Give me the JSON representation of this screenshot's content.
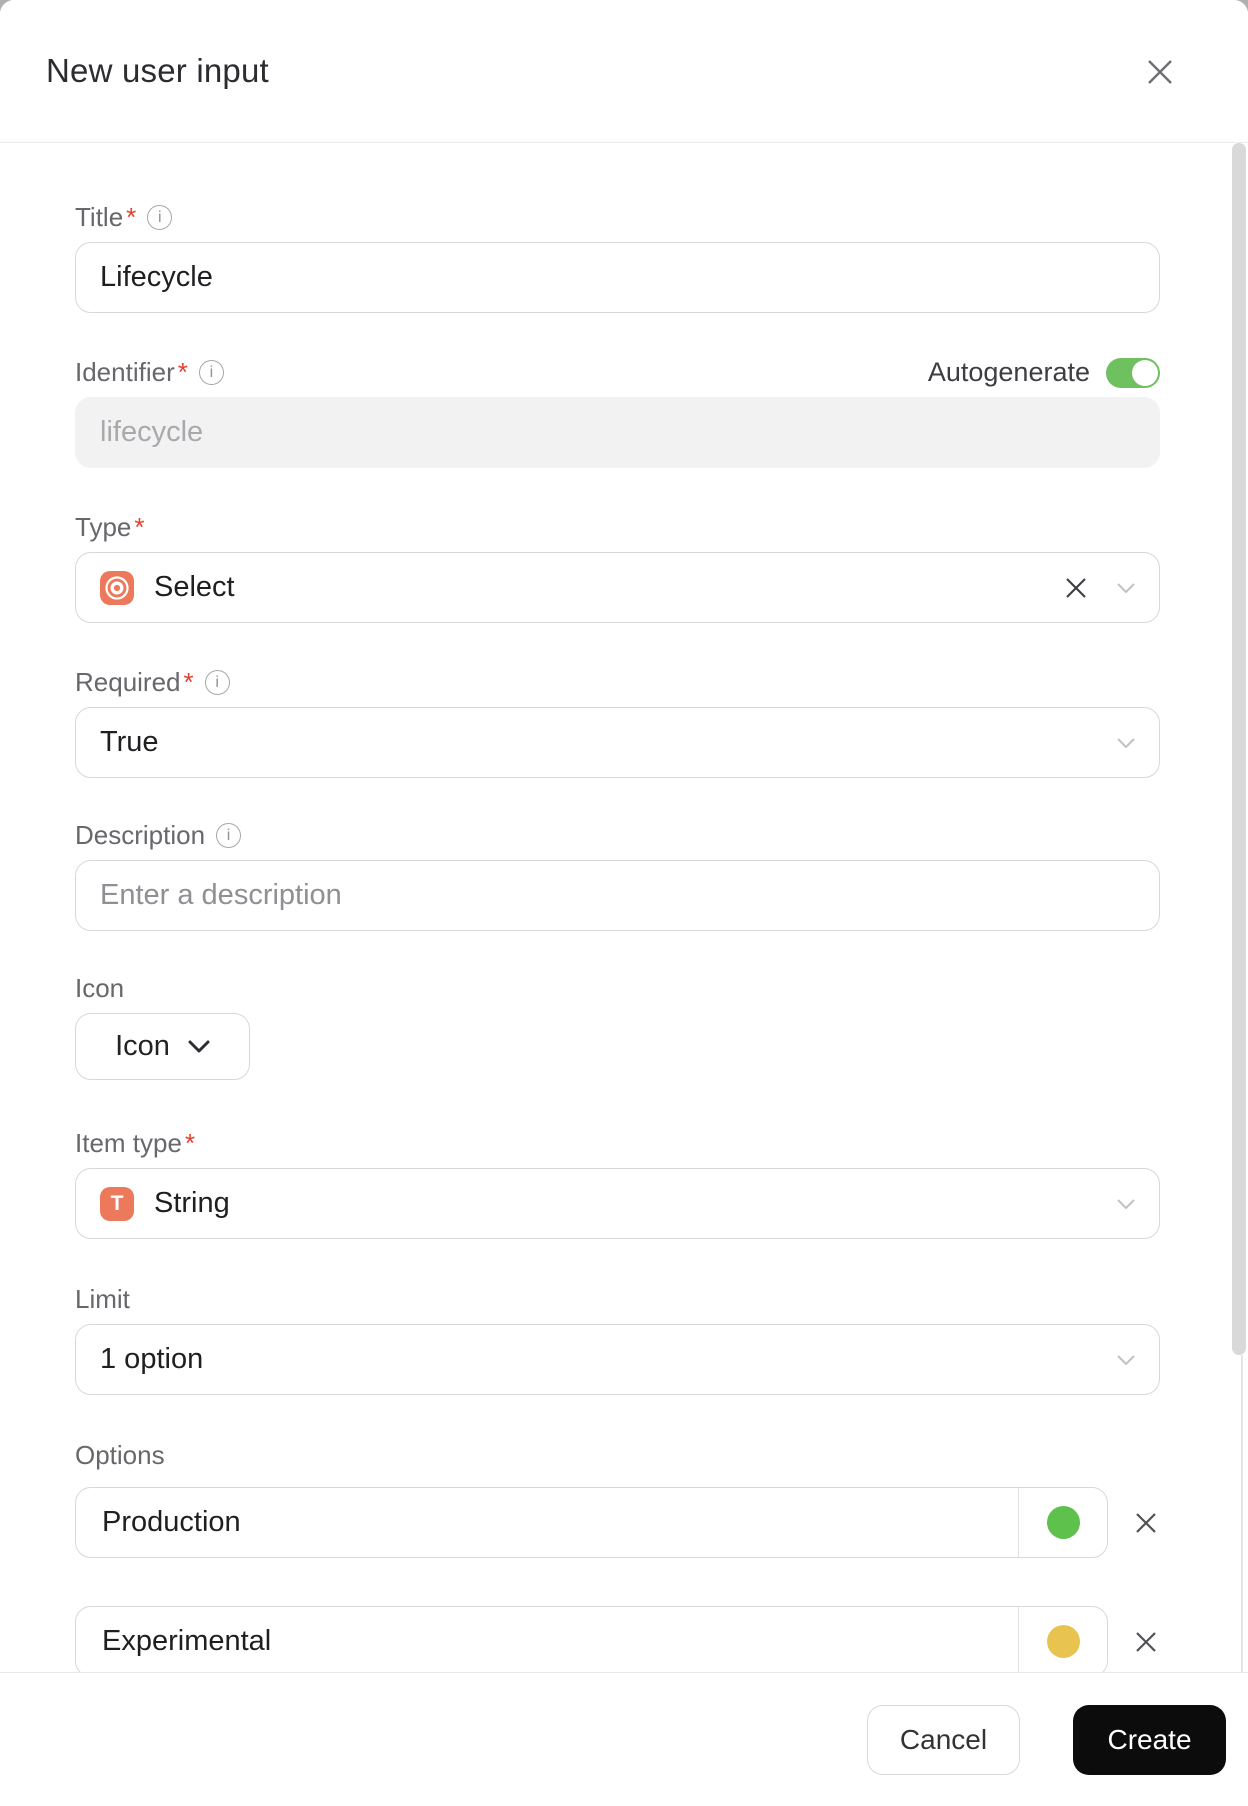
{
  "modal": {
    "title": "New user input"
  },
  "form": {
    "title": {
      "label": "Title",
      "asterisk": "*",
      "value": "Lifecycle"
    },
    "identifier": {
      "label": "Identifier",
      "asterisk": "*",
      "autogenerate_label": "Autogenerate",
      "autogenerate_on": true,
      "placeholder": "lifecycle"
    },
    "type": {
      "label": "Type",
      "asterisk": "*",
      "value": "Select",
      "icon": "select-target-icon"
    },
    "required": {
      "label": "Required",
      "asterisk": "*",
      "value": "True"
    },
    "description": {
      "label": "Description",
      "placeholder": "Enter a description"
    },
    "icon": {
      "label": "Icon",
      "button_label": "Icon"
    },
    "item_type": {
      "label": "Item type",
      "asterisk": "*",
      "value": "String",
      "badge_letter": "T"
    },
    "limit": {
      "label": "Limit",
      "value": "1 option"
    },
    "options": {
      "label": "Options",
      "items": [
        {
          "value": "Production",
          "dot_color": "#5dc14b"
        },
        {
          "value": "Experimental",
          "dot_color": "#e9c34f"
        }
      ]
    }
  },
  "footer": {
    "cancel_label": "Cancel",
    "create_label": "Create"
  },
  "colors": {
    "accent_orange": "#ed795c",
    "toggle_green": "#6fc160",
    "asterisk_red": "#e4402e",
    "create_button": "#0c0c0c"
  }
}
